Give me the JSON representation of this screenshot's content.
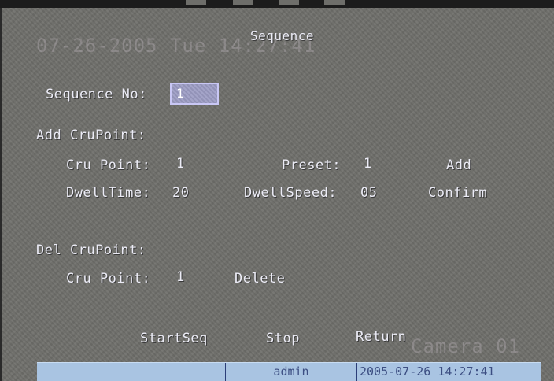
{
  "overlay": {
    "datetime": "07-26-2005 Tue 14:27:41",
    "camera_name": "Camera 01"
  },
  "page": {
    "title": "Sequence"
  },
  "sequence": {
    "label": "Sequence No:",
    "value": "1"
  },
  "add_section": {
    "title": "Add CruPoint:",
    "point_label": "Cru Point:",
    "point_value": "1",
    "preset_label": "Preset:",
    "preset_value": "1",
    "add_label": "Add",
    "dwelltime_label": "DwellTime:",
    "dwelltime_value": "20",
    "dwellspeed_label": "DwellSpeed:",
    "dwellspeed_value": "05",
    "confirm_label": "Confirm"
  },
  "del_section": {
    "title": "Del CruPoint:",
    "point_label": "Cru Point:",
    "point_value": "1",
    "delete_label": "Delete"
  },
  "actions": {
    "start_label": "StartSeq",
    "stop_label": "Stop",
    "return_label": "Return"
  },
  "status_bar": {
    "user": "admin",
    "datetime": "2005-07-26 14:27:41"
  },
  "colors": {
    "background": "#6e6e6a",
    "text": "#ececf6",
    "selected_field": "#9c9cc4",
    "status_bar": "#a9c4e2",
    "status_text": "#3c4e82"
  }
}
